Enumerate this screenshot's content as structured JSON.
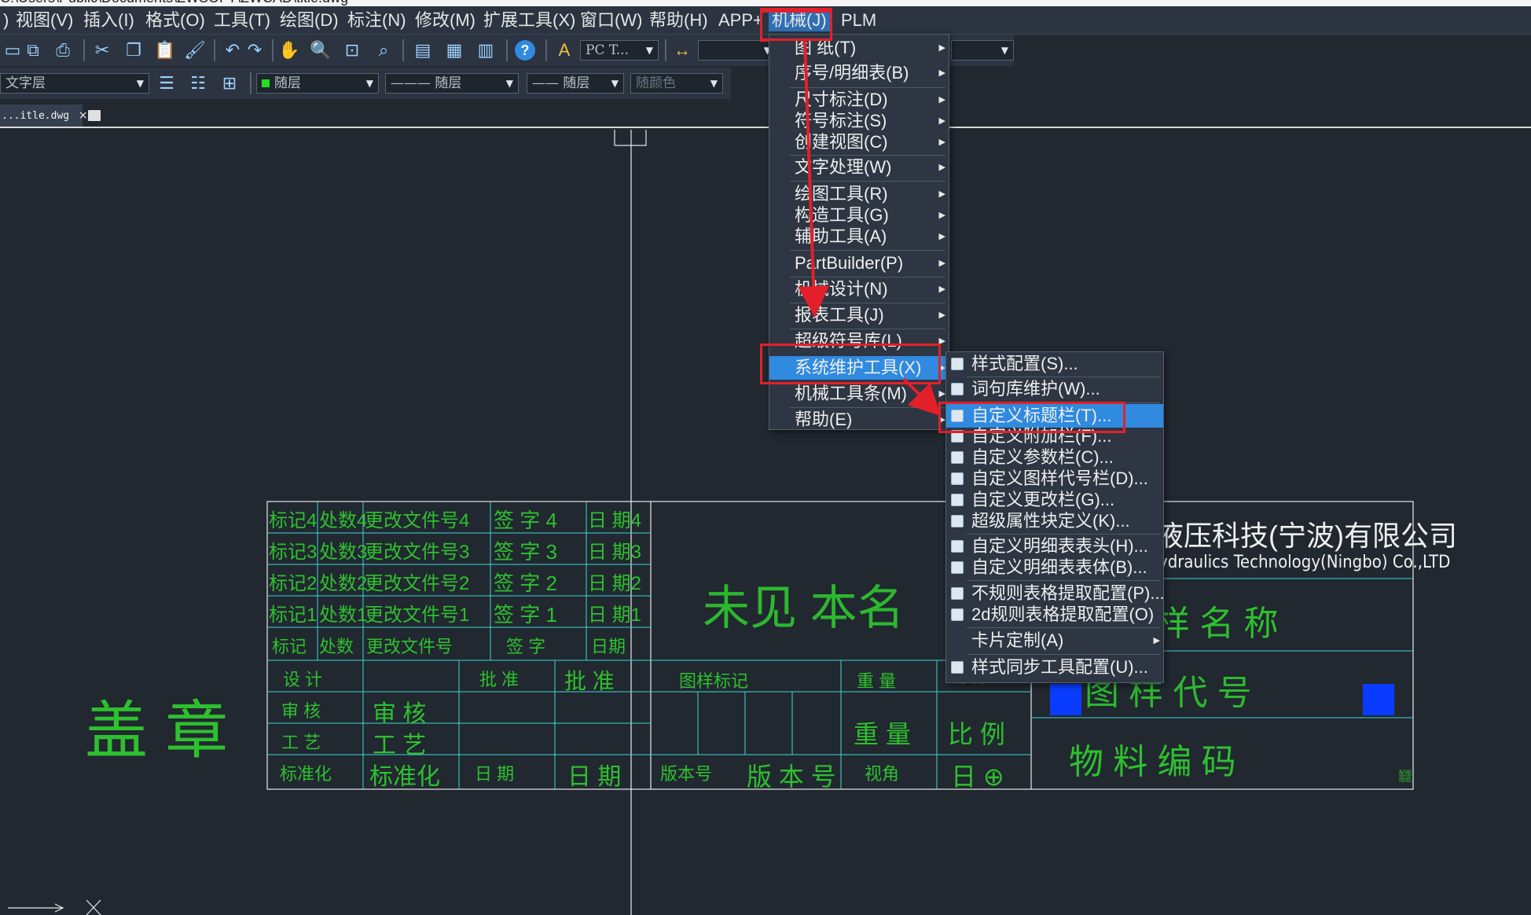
{
  "window": {
    "title_text": "C:\\Users\\Public\\Documents\\ZWSOFT\\ZWCAD\\title.dwg"
  },
  "menubar": {
    "items": [
      ")",
      "视图(V)",
      "插入(I)",
      "格式(O)",
      "工具(T)",
      "绘图(D)",
      "标注(N)",
      "修改(M)",
      "扩展工具(X)",
      "窗口(W)",
      "帮助(H)",
      "APP+",
      "机械(J)",
      "PLM"
    ]
  },
  "toolbar": {
    "text_style_combo": "PC T...",
    "layer_combo": "文字层",
    "color_combo": "随层",
    "linetype_combo": "——— 随层",
    "lineweight_combo": "—— 随层",
    "plotstyle_combo": "随颜色"
  },
  "document": {
    "tab_label": "...itle.dwg",
    "tab_close": "×"
  },
  "mech_menu": {
    "items": [
      "图    纸(T)",
      "序号/明细表(B)",
      "尺寸标注(D)",
      "符号标注(S)",
      "创建视图(C)",
      "文字处理(W)",
      "绘图工具(R)",
      "构造工具(G)",
      "辅助工具(A)",
      "PartBuilder(P)",
      "机械设计(N)",
      "报表工具(J)",
      "超级符号库(L)",
      "系统维护工具(X)",
      "机械工具条(M)",
      "帮助(E)"
    ]
  },
  "sys_menu": {
    "items": [
      "样式配置(S)...",
      "词句库维护(W)...",
      "自定义标题栏(T)...",
      "自定义附加栏(F)...",
      "自定义参数栏(C)...",
      "自定义图样代号栏(D)...",
      "自定义更改栏(G)...",
      "超级属性块定义(K)...",
      "自定义明细表表头(H)...",
      "自定义明细表表体(B)...",
      "不规则表格提取配置(P)...",
      "2d规则表格提取配置(O)",
      "卡片定制(A)",
      "样式同步工具配置(U)..."
    ]
  },
  "title_block": {
    "change_rows": [
      [
        "标记4",
        "处数4",
        "更改文件号4",
        "签 字 4",
        "日 期4"
      ],
      [
        "标记3",
        "处数3",
        "更改文件号3",
        "签 字 3",
        "日 期3"
      ],
      [
        "标记2",
        "处数2",
        "更改文件号2",
        "签 字 2",
        "日 期2"
      ],
      [
        "标记1",
        "处数1",
        "更改文件号1",
        "签 字 1",
        "日 期1"
      ]
    ],
    "change_header": [
      "标记",
      "处数",
      "更改文件号",
      "签 字",
      "日期"
    ],
    "stamp": "盖 章",
    "material_note": "未见 本名",
    "company_cn": "液压科技(宁波)有限公司",
    "company_en": "ydraulics Technology(Ningbo) Co.,LTD",
    "drawing_name": "样 名 称",
    "drawing_code": "图 样 代 号",
    "material_code": "物 料 编 码",
    "sign_rows": {
      "design": "设 计",
      "approve_label": "批 准",
      "approve_value": "批 准",
      "review_label": "审 核",
      "review_value": "审 核",
      "process_label": "工 艺",
      "process_value": "工 艺",
      "standard_label": "标准化",
      "standard_value": "标准化",
      "date_label": "日 期",
      "date_value": "日 期"
    },
    "mark_label": "图样标记",
    "weight_label": "重 量",
    "weight_value": "重 量",
    "scale_label": "比 例",
    "scale_value": "比 例",
    "version_label": "版本号",
    "version_value": "版 本 号",
    "view_label": "视角",
    "view_value": "日 ⊕",
    "tiny_tag": "配图 图纸"
  },
  "colors": {
    "cad_green": "#2ec02e",
    "highlight_red": "#e3202a",
    "select_blue": "#2f8ae0",
    "table_cyan": "#3fd6d6",
    "marker_blue": "#0a3cff"
  }
}
